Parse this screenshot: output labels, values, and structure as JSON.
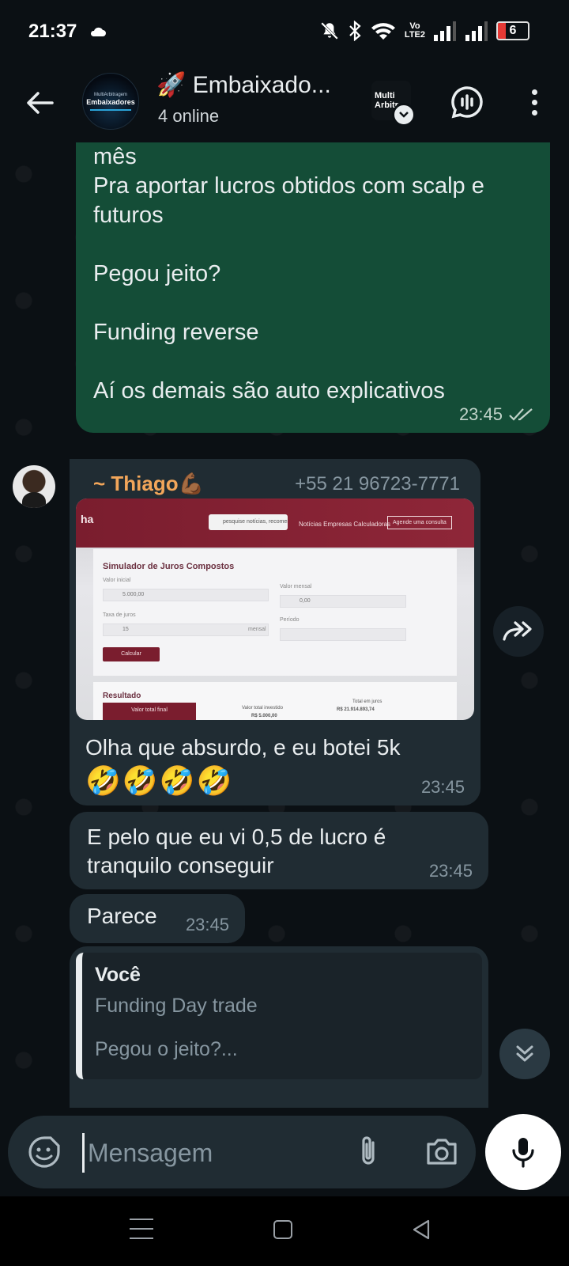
{
  "status_bar": {
    "time": "21:37",
    "network_top": "Vo",
    "network_bottom": "LTE2",
    "battery": "6",
    "icons": [
      "cloud-icon",
      "mute-icon",
      "bluetooth-icon",
      "wifi-icon",
      "signal-icon",
      "signal-icon",
      "battery-icon"
    ]
  },
  "header": {
    "group_title": "🚀 Embaixado...",
    "group_status": "4 online",
    "avatar_small_text": "MultiArbitragem",
    "avatar_text": "Embaixadores",
    "app_logo_line1": "Multi",
    "app_logo_line2": "Arbitr",
    "icons": [
      "back-arrow-icon",
      "chevron-down-icon",
      "voice-chat-icon",
      "more-vert-icon"
    ]
  },
  "messages": {
    "outgoing": {
      "text": "mês\nPra aportar lucros obtidos com scalp e futuros\n\nPegou jeito?\n\nFunding reverse\n\nAí os demais são auto explicativos",
      "time": "23:45",
      "status": "read"
    },
    "incoming_photo": {
      "sender_name": "~ Thiago💪🏾",
      "sender_phone": "+55 21 96723-7771",
      "caption": "Olha que absurdo, e eu botei 5k",
      "emojis": "🤣🤣🤣🤣",
      "time": "23:45",
      "photo": {
        "brand": "ha",
        "search_text": "pesquise notícias, recomendações",
        "nav_links": "Notícias   Empresas   Calculadoras",
        "cta": "Agende uma consulta",
        "title": "Simulador de Juros Compostos",
        "label_initial": "Valor inicial",
        "value_initial": "5.000,00",
        "label_monthly": "Valor mensal",
        "value_monthly": "0,00",
        "label_rate": "Taxa de juros",
        "value_rate": "15",
        "period_unit": "mensal",
        "label_period": "Período",
        "calc_button": "Calcular",
        "result_title": "Resultado",
        "result_final": "Valor total final",
        "result_invested": "Valor total investido",
        "result_invested_value": "R$ 5.000,00",
        "result_interest": "Total em juros",
        "result_interest_value": "R$ 21.914.893,74"
      }
    },
    "incoming_2": {
      "text": "E pelo que eu vi 0,5 de lucro é tranquilo conseguir",
      "time": "23:45"
    },
    "incoming_3": {
      "text": "Parece",
      "time": "23:45"
    },
    "incoming_reply": {
      "quote_author": "Você",
      "quote_line1": "Funding Day trade",
      "quote_line2": "Pegou o jeito?..."
    }
  },
  "input": {
    "placeholder": "Mensagem",
    "icons": [
      "sticker-icon",
      "attach-icon",
      "camera-icon",
      "mic-icon"
    ]
  },
  "floating": {
    "icons": [
      "forward-icon",
      "scroll-down-icon"
    ]
  },
  "nav": {
    "icons": [
      "recents-icon",
      "home-icon",
      "back-icon"
    ]
  },
  "colors": {
    "background": "#0b1014",
    "outgoing_bubble": "#144d37",
    "incoming_bubble": "#202c33",
    "sender_name": "#f2a65a",
    "meta_text": "#8696a0"
  }
}
